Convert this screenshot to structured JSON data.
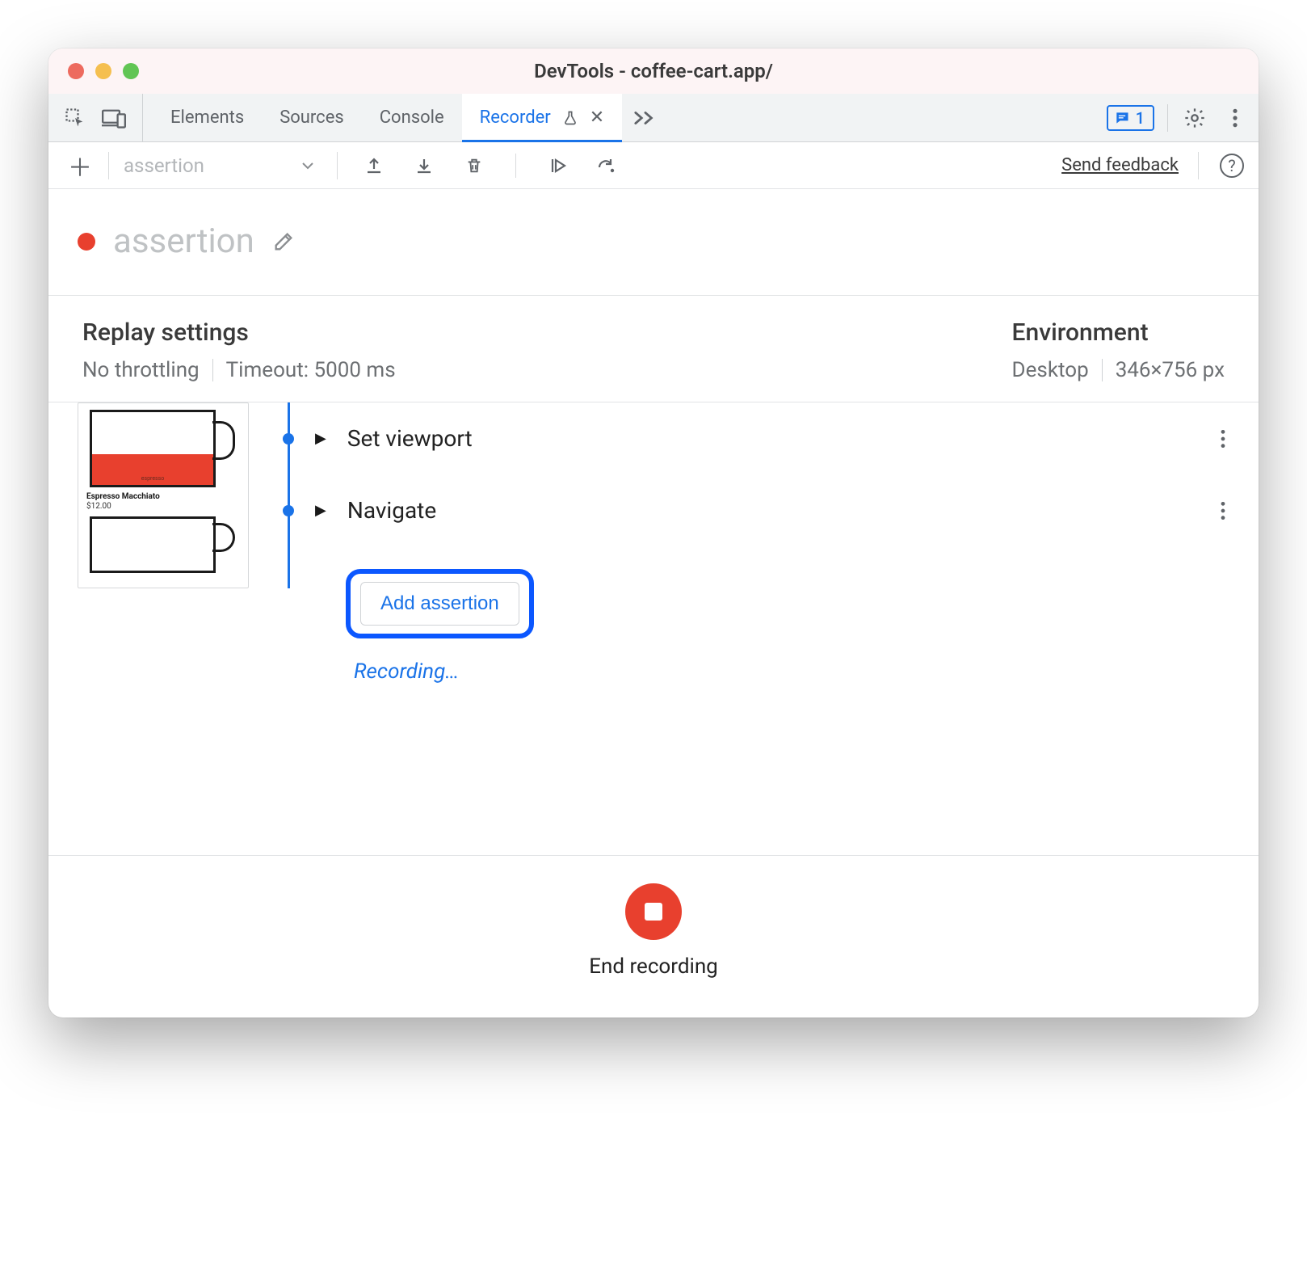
{
  "window": {
    "title": "DevTools - coffee-cart.app/"
  },
  "tabs": {
    "items": [
      "Elements",
      "Sources",
      "Console",
      "Recorder"
    ],
    "active_index": 3,
    "issues_count": "1"
  },
  "toolbar": {
    "dropdown_value": "assertion",
    "feedback_label": "Send feedback"
  },
  "recording": {
    "name": "assertion"
  },
  "replay": {
    "heading": "Replay settings",
    "throttling": "No throttling",
    "timeout": "Timeout: 5000 ms"
  },
  "environment": {
    "heading": "Environment",
    "device": "Desktop",
    "viewport": "346×756 px"
  },
  "thumbnail": {
    "product_name": "Espresso Macchiato",
    "product_price": "$12.00",
    "cup1_fill_label": "espresso"
  },
  "steps": [
    {
      "label": "Set viewport"
    },
    {
      "label": "Navigate"
    }
  ],
  "actions": {
    "add_assertion": "Add assertion",
    "recording_status": "Recording…"
  },
  "footer": {
    "end_label": "End recording"
  }
}
